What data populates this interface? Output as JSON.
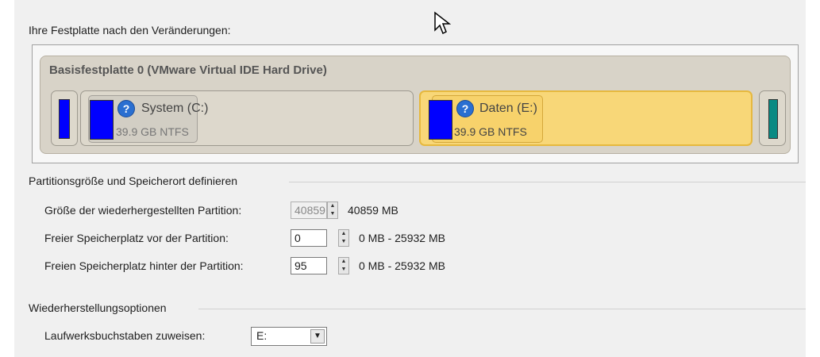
{
  "heading": "Ihre Festplatte nach den Veränderungen:",
  "disk": {
    "title": "Basisfestplatte 0 (VMware Virtual IDE Hard Drive)",
    "partitions": [
      {
        "name": "System (C:)",
        "info": "39.9 GB NTFS"
      },
      {
        "name": "Daten (E:)",
        "info": "39.9 GB NTFS"
      }
    ]
  },
  "size_section": {
    "title": "Partitionsgröße und Speicherort definieren",
    "rows": [
      {
        "label": "Größe der wiederhergestellten Partition:",
        "value": "40859",
        "range": "40859 MB"
      },
      {
        "label": "Freier Speicherplatz vor der Partition:",
        "value": "0",
        "range": "0 MB - 25932 MB"
      },
      {
        "label": "Freien Speicherplatz hinter der Partition:",
        "value": "95",
        "range": "0 MB - 25932 MB"
      }
    ]
  },
  "restore_section": {
    "title": "Wiederherstellungsoptionen",
    "drive_letter_label": "Laufwerksbuchstaben zuweisen:",
    "drive_letter_value": "E:"
  },
  "icons": {
    "partition_icon": "question-circle-icon",
    "cursor": "mouse-cursor-icon"
  },
  "colors": {
    "selected_partition": "#f8d778",
    "blue_bar": "#0000ff",
    "teal_bar": "#0a8a83"
  }
}
